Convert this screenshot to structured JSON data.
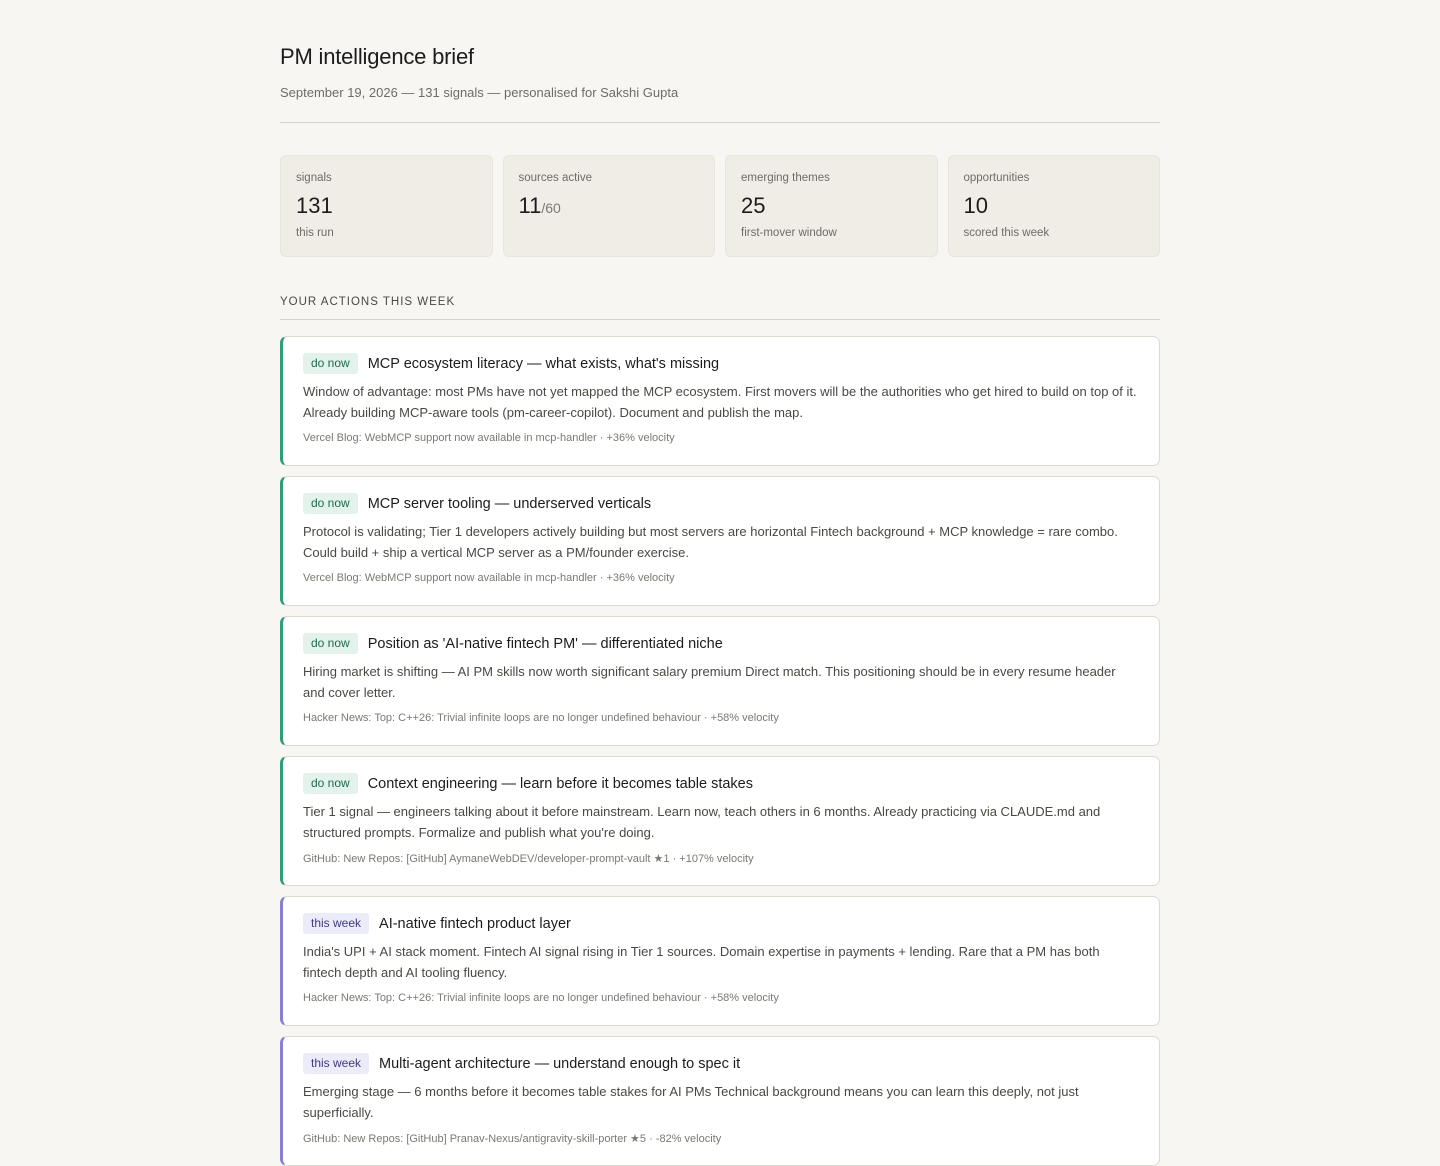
{
  "header": {
    "title": "PM intelligence brief",
    "subtitle": "September 19, 2026 — 131 signals — personalised for Sakshi Gupta"
  },
  "stats": [
    {
      "label": "signals",
      "value": "131",
      "denom": "",
      "sub": "this run"
    },
    {
      "label": "sources active",
      "value": "11",
      "denom": "/60",
      "sub": ""
    },
    {
      "label": "emerging themes",
      "value": "25",
      "denom": "",
      "sub": "first-mover window"
    },
    {
      "label": "opportunities",
      "value": "10",
      "denom": "",
      "sub": "scored this week"
    }
  ],
  "actions_heading": "YOUR ACTIONS THIS WEEK",
  "accent_colors": {
    "do_now": "#2f9e78",
    "this_week": "#8880d0"
  },
  "actions": [
    {
      "badge": "do now",
      "title": "MCP ecosystem literacy — what exists, what's missing",
      "body": "Window of advantage: most PMs have not yet mapped the MCP ecosystem. First movers will be the authorities who get hired to build on top of it. Already building MCP-aware tools (pm-career-copilot). Document and publish the map.",
      "source": "Vercel Blog: WebMCP support now available in mcp-handler · +36% velocity"
    },
    {
      "badge": "do now",
      "title": "MCP server tooling — underserved verticals",
      "body": "Protocol is validating; Tier 1 developers actively building but most servers are horizontal Fintech background + MCP knowledge = rare combo. Could build + ship a vertical MCP server as a PM/founder exercise.",
      "source": "Vercel Blog: WebMCP support now available in mcp-handler · +36% velocity"
    },
    {
      "badge": "do now",
      "title": "Position as 'AI-native fintech PM' — differentiated niche",
      "body": "Hiring market is shifting — AI PM skills now worth significant salary premium Direct match. This positioning should be in every resume header and cover letter.",
      "source": "Hacker News: Top: C++26: Trivial infinite loops are no longer undefined behaviour · +58% velocity"
    },
    {
      "badge": "do now",
      "title": "Context engineering — learn before it becomes table stakes",
      "body": "Tier 1 signal — engineers talking about it before mainstream. Learn now, teach others in 6 months. Already practicing via CLAUDE.md and structured prompts. Formalize and publish what you're doing.",
      "source": "GitHub: New Repos: [GitHub] AymaneWebDEV/developer-prompt-vault ★1 · +107% velocity"
    },
    {
      "badge": "this week",
      "title": "AI-native fintech product layer",
      "body": "India's UPI + AI stack moment. Fintech AI signal rising in Tier 1 sources. Domain expertise in payments + lending. Rare that a PM has both fintech depth and AI tooling fluency.",
      "source": "Hacker News: Top: C++26: Trivial infinite loops are no longer undefined behaviour · +58% velocity"
    },
    {
      "badge": "this week",
      "title": "Multi-agent architecture — understand enough to spec it",
      "body": "Emerging stage — 6 months before it becomes table stakes for AI PMs Technical background means you can learn this deeply, not just superficially.",
      "source": "GitHub: New Repos: [GitHub] Pranav-Nexus/antigravity-skill-porter ★5 · -82% velocity"
    }
  ]
}
